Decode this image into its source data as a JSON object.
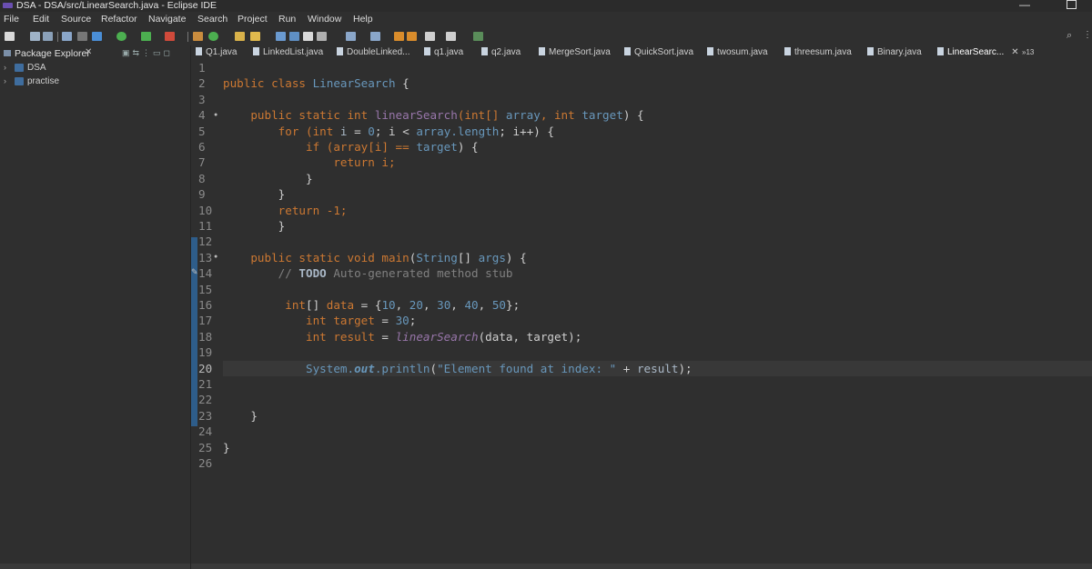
{
  "window": {
    "title": "DSA - DSA/src/LinearSearch.java - Eclipse IDE"
  },
  "menu": [
    "File",
    "Edit",
    "Source",
    "Refactor",
    "Navigate",
    "Search",
    "Project",
    "Run",
    "Window",
    "Help"
  ],
  "package_explorer": {
    "title": "Package Explorer",
    "projects": [
      "DSA",
      "practise"
    ]
  },
  "tabs": [
    {
      "label": "Q1.java"
    },
    {
      "label": "LinkedList.java"
    },
    {
      "label": "DoubleLinked..."
    },
    {
      "label": "q1.java"
    },
    {
      "label": "q2.java"
    },
    {
      "label": "MergeSort.java"
    },
    {
      "label": "QuickSort.java"
    },
    {
      "label": "twosum.java"
    },
    {
      "label": "threesum.java"
    },
    {
      "label": "Binary.java"
    },
    {
      "label": "LinearSearc..."
    }
  ],
  "tabs_overflow": "»13",
  "editor": {
    "line_numbers": [
      "1",
      "2",
      "3",
      "4",
      "5",
      "6",
      "7",
      "8",
      "9",
      "10",
      "11",
      "12",
      "13",
      "14",
      "15",
      "16",
      "17",
      "18",
      "19",
      "20",
      "21",
      "22",
      "23",
      "24",
      "25",
      "26"
    ],
    "code": {
      "l2a": "public class ",
      "l2b": "LinearSearch",
      "l2c": " {",
      "l4a": "    public static int ",
      "l4b": "linearSearch",
      "l4c": "(int[] ",
      "l4d": "array",
      "l4e": ", int ",
      "l4f": "target",
      "l4g": ") {",
      "l5a": "        for ",
      "l5b": "(int ",
      "l5c": "i",
      "l5d": " = ",
      "l5e": "0",
      "l5f": "; i < ",
      "l5g": "array.length",
      "l5h": "; i++) {",
      "l6a": "            if ",
      "l6b": "(array[i] == ",
      "l6c": "target",
      "l6d": ") {",
      "l7a": "                return ",
      "l7b": "i;",
      "l8": "            }",
      "l9": "        }",
      "l10a": "        return ",
      "l10b": "-1;",
      "l11": "        }",
      "l13a": "    public static void ",
      "l13b": "main",
      "l13c": "(",
      "l13d": "String",
      "l13e": "[] ",
      "l13f": "args",
      "l13g": ") {",
      "l14a": "        // ",
      "l14b": "TODO",
      "l14c": " Auto-generated method stub",
      "l16a": "         int",
      "l16b": "[] ",
      "l16c": "data",
      "l16d": " = {",
      "l16e": "10",
      "l16f": ", ",
      "l16g": "20",
      "l16h": ", ",
      "l16i": "30",
      "l16j": ", ",
      "l16k": "40",
      "l16l": ", ",
      "l16m": "50",
      "l16n": "};",
      "l17a": "            int ",
      "l17b": "target",
      "l17c": " = ",
      "l17d": "30",
      "l17e": ";",
      "l18a": "            int ",
      "l18b": "result",
      "l18c": " = ",
      "l18d": "linearSearch",
      "l18e": "(data, ",
      "l18f": "target",
      "l18g": ");",
      "l20a": "            System.",
      "l20b": "out",
      "l20c": ".",
      "l20d": "println",
      "l20e": "(",
      "l20f": "\"Element found at index: \"",
      "l20g": " + ",
      "l20h": "result",
      "l20i": ");",
      "l23": "    }",
      "l25": "}"
    }
  }
}
